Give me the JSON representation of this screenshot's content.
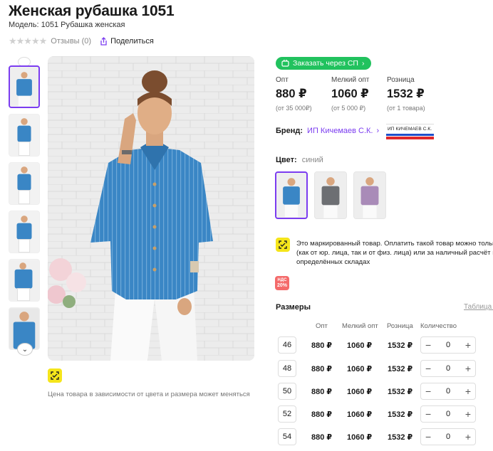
{
  "product": {
    "title": "Женская рубашка 1051",
    "model": "Модель: 1051 Рубашка женская",
    "rating_stars": "★★★★★",
    "reviews": "Отзывы (0)",
    "share": "Поделиться"
  },
  "gallery": {
    "thumbnails": [
      "thumb-1",
      "thumb-2",
      "thumb-3",
      "thumb-4",
      "thumb-5",
      "thumb-6"
    ],
    "price_note": "Цена товара в зависимости от цвета и размера может меняться"
  },
  "order": {
    "button": "Заказать через СП"
  },
  "prices": [
    {
      "label": "Опт",
      "value": "880 ₽",
      "sub": "(от 35 000₽)"
    },
    {
      "label": "Мелкий опт",
      "value": "1060 ₽",
      "sub": "(от 5 000 ₽)"
    },
    {
      "label": "Розница",
      "value": "1532 ₽",
      "sub": "(от 1 товара)"
    }
  ],
  "brand": {
    "label": "Бренд:",
    "name": "ИП Кичемаев С.К.",
    "logo_text": "ИП КИЧЕМАЕВ С.К."
  },
  "color": {
    "label": "Цвет:",
    "value": "синий",
    "swatches": [
      {
        "name": "blue",
        "hex": "#3a86c5"
      },
      {
        "name": "gray",
        "hex": "#6d6f73"
      },
      {
        "name": "lilac",
        "hex": "#a98bb8"
      }
    ]
  },
  "marking": {
    "lines": [
      "Это маркированный товар. Оплатить такой товар можно только",
      "(как от юр. лица, так и от физ. лица) или за наличный расчёт на",
      "определённых складах"
    ]
  },
  "vat": {
    "line1": "НДС",
    "line2": "20%"
  },
  "sizes": {
    "title": "Размеры",
    "table_link": "Таблица р",
    "headers": {
      "wholesale": "Опт",
      "small": "Мелкий опт",
      "retail": "Розница",
      "qty": "Количество"
    },
    "rows": [
      {
        "size": "46",
        "wholesale": "880 ₽",
        "small": "1060 ₽",
        "retail": "1532 ₽",
        "qty": "0"
      },
      {
        "size": "48",
        "wholesale": "880 ₽",
        "small": "1060 ₽",
        "retail": "1532 ₽",
        "qty": "0"
      },
      {
        "size": "50",
        "wholesale": "880 ₽",
        "small": "1060 ₽",
        "retail": "1532 ₽",
        "qty": "0"
      },
      {
        "size": "52",
        "wholesale": "880 ₽",
        "small": "1060 ₽",
        "retail": "1532 ₽",
        "qty": "0"
      },
      {
        "size": "54",
        "wholesale": "880 ₽",
        "small": "1060 ₽",
        "retail": "1532 ₽",
        "qty": "0"
      }
    ],
    "minus": "−",
    "plus": "+"
  },
  "colors": {
    "accent": "#7b3cf0",
    "green": "#21c25e",
    "honest_sign": "#f5e51b",
    "vat": "#f46a6a",
    "shirt": "#3a86c5"
  }
}
